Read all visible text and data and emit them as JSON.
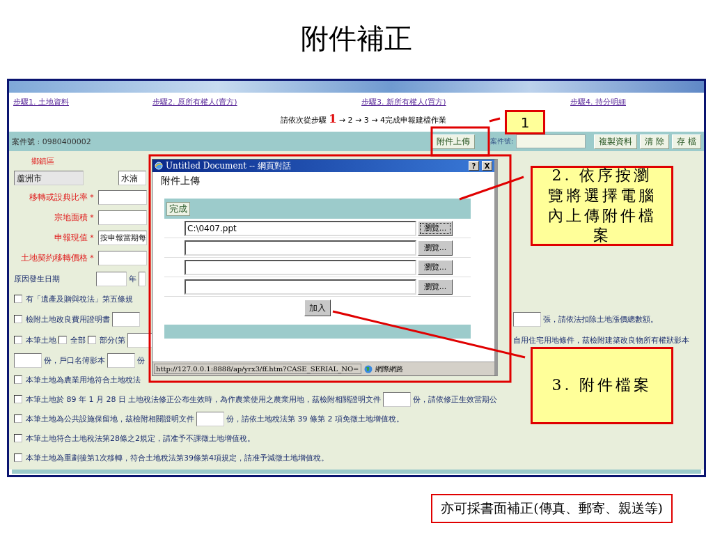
{
  "title": "附件補正",
  "browser": {
    "steps": [
      {
        "label": "步驟1. 土地資料"
      },
      {
        "label": "步驟2. 原所有權人(賣方)"
      },
      {
        "label": "步驟3. 新所有權人(買方)"
      },
      {
        "label": "步驟4. 持分明細"
      }
    ],
    "instruction": {
      "lead": "請依次從步驟",
      "step": "1",
      "rest": "→ 2 → 3 → 4完成申報建檔作業"
    },
    "toolbar": {
      "case_number": "案件號 : 0980400002",
      "upload_button": "附件上傳",
      "search_label": "案件號:",
      "buttons": [
        "複製資料",
        "清 除",
        "存 檔"
      ]
    },
    "form": {
      "rows": [
        {
          "kind": "caption",
          "text": "鄉鎮區"
        },
        {
          "kind": "location",
          "fields": [
            {
              "value": "蘆洲市",
              "readonly": true
            },
            {
              "value": "水湳",
              "readonly": false
            }
          ]
        },
        {
          "kind": "labeled",
          "label": "移轉或設典比率＊"
        },
        {
          "kind": "labeled",
          "label": "宗地面積＊"
        },
        {
          "kind": "labeled",
          "label": "申報現值＊",
          "value": "按申報當期每"
        },
        {
          "kind": "labeled",
          "label": "土地契約移轉價格＊"
        },
        {
          "kind": "date",
          "label": "原因發生日期",
          "unit": "年"
        },
        {
          "kind": "parts",
          "parts": [
            {
              "kind": "checkbox",
              "checked": false
            },
            {
              "kind": "text",
              "text": "有「遺產及贈與稅法」第五條規"
            }
          ]
        },
        {
          "kind": "parts",
          "parts": [
            {
              "kind": "checkbox",
              "checked": false
            },
            {
              "kind": "text",
              "text": "檢附土地改良費用證明書"
            },
            {
              "kind": "input"
            }
          ],
          "trailing": [
            {
              "kind": "input"
            },
            {
              "kind": "text",
              "text": "張，請依法扣除土地漲價總數額。"
            }
          ]
        },
        {
          "kind": "parts",
          "parts": [
            {
              "kind": "checkbox",
              "checked": false
            },
            {
              "kind": "text",
              "text": "本筆土地"
            },
            {
              "kind": "checkbox",
              "checked": false
            },
            {
              "kind": "text",
              "text": "全部"
            },
            {
              "kind": "checkbox",
              "checked": false
            },
            {
              "kind": "text",
              "text": "部分(第"
            },
            {
              "kind": "input"
            }
          ],
          "trailing": [
            {
              "kind": "text",
              "text": "自用住宅用地條件，茲檢附建築改良物所有權狀影本"
            }
          ]
        },
        {
          "kind": "parts",
          "parts": [
            {
              "kind": "input"
            },
            {
              "kind": "text",
              "text": "份，戶口名簿影本"
            },
            {
              "kind": "input"
            },
            {
              "kind": "text",
              "text": "份"
            }
          ]
        },
        {
          "kind": "parts",
          "parts": [
            {
              "kind": "checkbox",
              "checked": false
            },
            {
              "kind": "text",
              "text": "本筆土地為農業用地符合土地稅法"
            }
          ]
        },
        {
          "kind": "parts",
          "parts": [
            {
              "kind": "checkbox",
              "checked": false
            },
            {
              "kind": "text",
              "text": "本筆土地於 89 年 1 月 28 日 土地稅法修正公布生效時，為作農業使用之農業用地，茲檢附相關證明文件"
            },
            {
              "kind": "input"
            },
            {
              "kind": "text",
              "text": "份，請依修正生效當期公"
            }
          ]
        },
        {
          "kind": "parts",
          "parts": [
            {
              "kind": "checkbox",
              "checked": false
            },
            {
              "kind": "text",
              "text": "本筆土地為公共設施保留地，茲檢附相關證明文件"
            },
            {
              "kind": "input"
            },
            {
              "kind": "text",
              "text": "份，請依土地稅法第 39 條第 2 項免徵土地增值稅。"
            }
          ]
        },
        {
          "kind": "parts",
          "parts": [
            {
              "kind": "checkbox",
              "checked": false
            },
            {
              "kind": "text",
              "text": "本筆土地符合土地稅法第28條之2規定，請准予不課徵土地增值稅。"
            }
          ]
        },
        {
          "kind": "parts",
          "parts": [
            {
              "kind": "checkbox",
              "checked": false
            },
            {
              "kind": "text",
              "text": "本筆土地為重劃後第1次移轉，符合土地稅法第39條第4項規定，請准予減徵土地增值稅。"
            }
          ]
        }
      ]
    }
  },
  "dialog": {
    "title": "Untitled Document -- 網頁對話",
    "window_buttons": [
      "?",
      "X"
    ],
    "heading": "附件上傳",
    "done_button": "完成",
    "files": [
      {
        "value": "C:\\0407.ppt",
        "browse": "瀏覽...",
        "focused": true
      },
      {
        "browse": "瀏覽...",
        "focused": false
      },
      {
        "browse": "瀏覽...",
        "focused": false
      },
      {
        "browse": "瀏覽...",
        "focused": false
      }
    ],
    "add_button": "加入",
    "status_url": "http://127.0.0.1:8888/ap/yrx3/ff.htm?CASE_SERIAL_NO=",
    "status_zone": "網際網路"
  },
  "callouts": [
    {
      "text": "1"
    },
    {
      "text": "2. 依序按瀏覽將選擇電腦內上傳附件檔案"
    },
    {
      "text": "3. 附件檔案"
    }
  ],
  "note": "亦可採書面補正(傳真、郵寄、親送等)"
}
